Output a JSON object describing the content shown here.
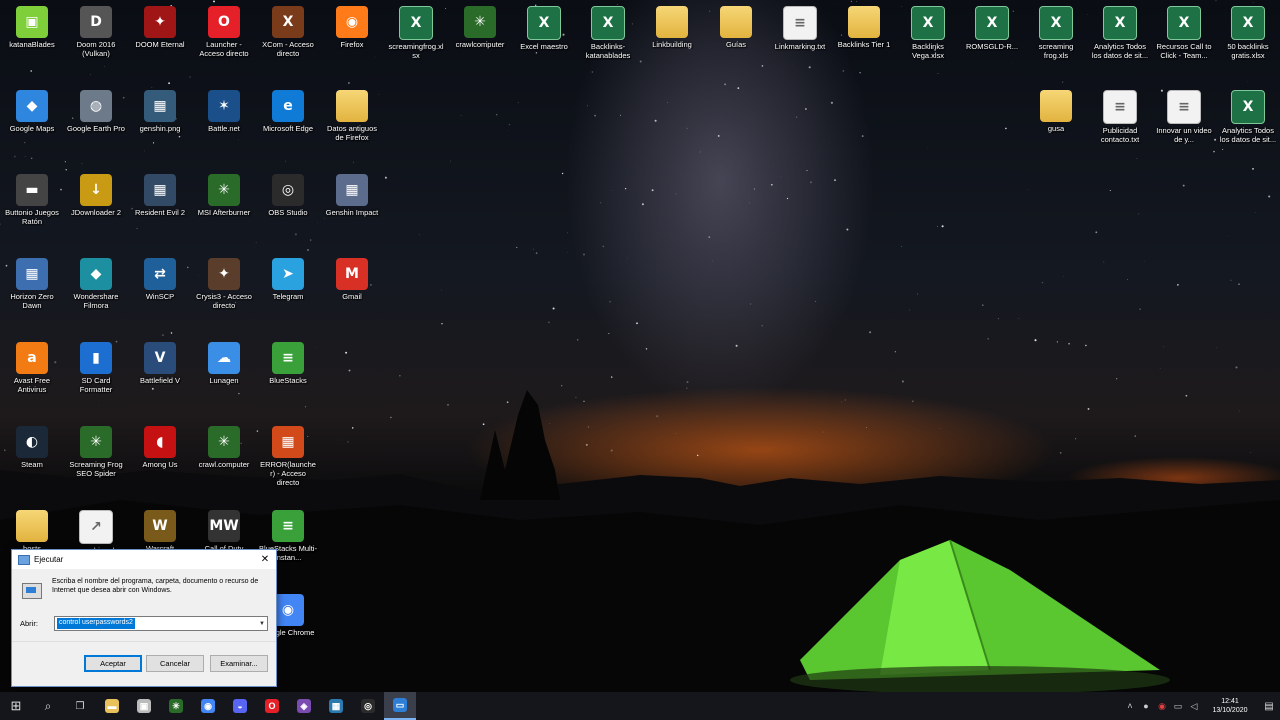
{
  "desktop": {
    "icons": [
      {
        "label": "katanaBlades",
        "type": "app",
        "glyph": "▣",
        "color": "#7fcf3a"
      },
      {
        "label": "Doom 2016 (Vulkan)",
        "type": "app",
        "glyph": "D",
        "color": "#555"
      },
      {
        "label": "DOOM Eternal",
        "type": "app",
        "glyph": "✦",
        "color": "#a01616"
      },
      {
        "label": "Launcher - Acceso directo",
        "type": "app",
        "glyph": "O",
        "color": "#e52028"
      },
      {
        "label": "XCom - Acceso directo",
        "type": "app",
        "glyph": "X",
        "color": "#7a3b1a"
      },
      {
        "label": "Firefox",
        "type": "app",
        "glyph": "◉",
        "color": "#ff7a18"
      },
      {
        "label": "screamingfrog.xlsx",
        "type": "xls",
        "glyph": "X",
        "color": "#1e7145"
      },
      {
        "label": "crawlcomputer",
        "type": "app",
        "glyph": "✳",
        "color": "#2a6b2a"
      },
      {
        "label": "Excel maestro",
        "type": "xls",
        "glyph": "X",
        "color": "#1e7145"
      },
      {
        "label": "Backlinks-katanablades",
        "type": "xls",
        "glyph": "X",
        "color": "#1e7145"
      },
      {
        "label": "Linkbuilding",
        "type": "folder",
        "glyph": "",
        "color": "#e8c15a"
      },
      {
        "label": "Guías",
        "type": "folder",
        "glyph": "",
        "color": "#e8c15a"
      },
      {
        "label": "Linkmarking.txt",
        "type": "doc",
        "glyph": "≡",
        "color": "#eee"
      },
      {
        "label": "Backlinks Tier 1",
        "type": "folder",
        "glyph": "",
        "color": "#e8c15a"
      },
      {
        "label": "Backlinks Vega.xlsx",
        "type": "xls",
        "glyph": "X",
        "color": "#1e7145"
      },
      {
        "label": "ROMSGLD-R...",
        "type": "xls",
        "glyph": "X",
        "color": "#1e7145"
      },
      {
        "label": "screaming frog.xls",
        "type": "xls",
        "glyph": "X",
        "color": "#1e7145"
      },
      {
        "label": "Analytics Todos los datos de sit...",
        "type": "xls",
        "glyph": "X",
        "color": "#1e7145"
      },
      {
        "label": "Recursos Call to Click - Team...",
        "type": "xls",
        "glyph": "X",
        "color": "#1e7145"
      },
      {
        "label": "50 backlinks gratis.xlsx",
        "type": "xls",
        "glyph": "X",
        "color": "#1e7145"
      },
      {
        "label": "Google Maps",
        "type": "app",
        "glyph": "◆",
        "color": "#2e86de"
      },
      {
        "label": "Google Earth Pro",
        "type": "app",
        "glyph": "◍",
        "color": "#6c7a89"
      },
      {
        "label": "genshin.png",
        "type": "app",
        "glyph": "▦",
        "color": "#355b7a"
      },
      {
        "label": "Battle.net",
        "type": "app",
        "glyph": "✶",
        "color": "#1a4f8a"
      },
      {
        "label": "Microsoft Edge",
        "type": "app",
        "glyph": "e",
        "color": "#0f7bd6"
      },
      {
        "label": "Datos antiguos de Firefox",
        "type": "folder",
        "glyph": "",
        "color": "#e8c15a"
      },
      {
        "label": "gusa",
        "type": "folder",
        "glyph": "",
        "color": "#e8c15a"
      },
      {
        "label": "Publicidad contacto.txt",
        "type": "doc",
        "glyph": "≡",
        "color": "#eee"
      },
      {
        "label": "Innovar un video de y...",
        "type": "doc",
        "glyph": "≡",
        "color": "#eee"
      },
      {
        "label": "Analytics Todos los datos de sit...",
        "type": "xls",
        "glyph": "X",
        "color": "#1e7145"
      },
      {
        "label": "Buttonio Juegos Ratón",
        "type": "app",
        "glyph": "▬",
        "color": "#444"
      },
      {
        "label": "JDownloader 2",
        "type": "app",
        "glyph": "↓",
        "color": "#c99a14"
      },
      {
        "label": "Resident Evil 2",
        "type": "app",
        "glyph": "▦",
        "color": "#324a66"
      },
      {
        "label": "MSI Afterburner",
        "type": "app",
        "glyph": "✳",
        "color": "#2a6b2a"
      },
      {
        "label": "OBS Studio",
        "type": "app",
        "glyph": "◎",
        "color": "#2b2b2b"
      },
      {
        "label": "Genshin Impact",
        "type": "app",
        "glyph": "▦",
        "color": "#5b6c8c"
      },
      {
        "label": "Horizon Zero Dawn",
        "type": "app",
        "glyph": "▦",
        "color": "#3d6fb0"
      },
      {
        "label": "Wondershare Filmora",
        "type": "app",
        "glyph": "◆",
        "color": "#1c8fa0"
      },
      {
        "label": "WinSCP",
        "type": "app",
        "glyph": "⇄",
        "color": "#1f5f9a"
      },
      {
        "label": "Crysis3 - Acceso directo",
        "type": "app",
        "glyph": "✦",
        "color": "#5a3d2a"
      },
      {
        "label": "Telegram",
        "type": "app",
        "glyph": "➤",
        "color": "#2aa2e0"
      },
      {
        "label": "Gmail",
        "type": "app",
        "glyph": "M",
        "color": "#d93025"
      },
      {
        "label": "Avast Free Antivirus",
        "type": "app",
        "glyph": "a",
        "color": "#f27b14"
      },
      {
        "label": "SD Card Formatter",
        "type": "app",
        "glyph": "▮",
        "color": "#1c6fd0"
      },
      {
        "label": "Battlefield V",
        "type": "app",
        "glyph": "V",
        "color": "#2a4c7a"
      },
      {
        "label": "Lunagen",
        "type": "app",
        "glyph": "☁",
        "color": "#3a8ee6"
      },
      {
        "label": "BlueStacks",
        "type": "app",
        "glyph": "≡",
        "color": "#3aa13a"
      },
      {
        "label": "Steam",
        "type": "app",
        "glyph": "◐",
        "color": "#1b2838"
      },
      {
        "label": "Screaming Frog SEO Spider",
        "type": "app",
        "glyph": "✳",
        "color": "#2a6b2a"
      },
      {
        "label": "Among Us",
        "type": "app",
        "glyph": "◖",
        "color": "#c51111"
      },
      {
        "label": "crawl.computer",
        "type": "app",
        "glyph": "✳",
        "color": "#2a6b2a"
      },
      {
        "label": "ERROR(launcher) - Acceso directo",
        "type": "app",
        "glyph": "▦",
        "color": "#d24a1a"
      },
      {
        "label": "hosts",
        "type": "folder",
        "glyph": "",
        "color": "#e8c15a"
      },
      {
        "label": "genshin.url",
        "type": "doc",
        "glyph": "↗",
        "color": "#ddd"
      },
      {
        "label": "Warcraft",
        "type": "app",
        "glyph": "W",
        "color": "#7a5a1a"
      },
      {
        "label": "Call of Duty",
        "type": "app",
        "glyph": "MW",
        "color": "#333"
      },
      {
        "label": "BlueStacks Multi-Instan...",
        "type": "app",
        "glyph": "≡",
        "color": "#3aa13a"
      },
      {
        "label": "Google Chrome",
        "type": "app",
        "glyph": "◉",
        "color": "#4285f4"
      }
    ]
  },
  "run_dialog": {
    "title": "Ejecutar",
    "description": "Escriba el nombre del programa, carpeta, documento o recurso de Internet que desea abrir con Windows.",
    "open_label": "Abrir:",
    "open_value": "control userpasswords2",
    "ok_label": "Aceptar",
    "cancel_label": "Cancelar",
    "browse_label": "Examinar..."
  },
  "taskbar": {
    "start_glyph": "⊞",
    "search_glyph": "⌕",
    "taskview_glyph": "❐",
    "pinned": [
      {
        "name": "file-explorer-icon",
        "glyph": "▬",
        "color": "#e8c15a"
      },
      {
        "name": "store-icon",
        "glyph": "▣",
        "color": "#bbb"
      },
      {
        "name": "frog-icon",
        "glyph": "✳",
        "color": "#2a6b2a"
      },
      {
        "name": "chrome-icon",
        "glyph": "◉",
        "color": "#4285f4"
      },
      {
        "name": "discord-icon",
        "glyph": "◒",
        "color": "#5865f2"
      },
      {
        "name": "opera-icon",
        "glyph": "O",
        "color": "#e52028"
      },
      {
        "name": "unknown-app-icon",
        "glyph": "◈",
        "color": "#7a4bb0"
      },
      {
        "name": "app-icon",
        "glyph": "▦",
        "color": "#2a7ab0"
      },
      {
        "name": "obs-icon",
        "glyph": "◎",
        "color": "#2b2b2b"
      },
      {
        "name": "run-window-icon",
        "glyph": "▭",
        "color": "#2d7fd6"
      }
    ],
    "time": "12:41",
    "date": "13/10/2020"
  }
}
